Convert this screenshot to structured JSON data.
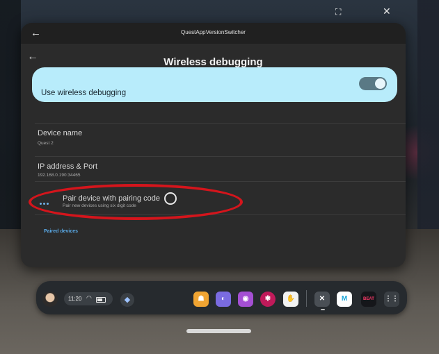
{
  "window": {
    "title": "QuestAppVersionSwitcher",
    "back_glyph": "←",
    "expand_glyph": "⛶",
    "close_glyph": "✕"
  },
  "page": {
    "back_glyph": "←",
    "title": "Wireless debugging"
  },
  "toggle": {
    "label": "Use wireless debugging",
    "state": "on"
  },
  "settings": {
    "device_name": {
      "title": "Device name",
      "value": "Quest 2"
    },
    "ip_address": {
      "title": "IP address & Port",
      "value": "192.168.0.190:34465"
    },
    "pair": {
      "title": "Pair device with pairing code",
      "subtitle": "Pair new devices using six digit code"
    },
    "paired_section": "Paired devices"
  },
  "dock": {
    "time": "11:20",
    "wifi_icon": "wifi-icon",
    "battery_icon": "battery-icon",
    "notification_icon": "bell-icon",
    "apps": [
      {
        "name": "app-orange",
        "color": "#f0a432",
        "glyph": "☗"
      },
      {
        "name": "app-purple-blue",
        "color": "#7a6be0",
        "glyph": "◐"
      },
      {
        "name": "app-people",
        "color": "#a44fd3",
        "glyph": "◉"
      },
      {
        "name": "app-pink-wheel",
        "color": "#c01a5a",
        "glyph": "✱"
      },
      {
        "name": "app-white-figure",
        "color": "#f2f2f2",
        "glyph": "✋"
      },
      {
        "name": "app-x",
        "color": "#4a4f55",
        "glyph": "✕"
      },
      {
        "name": "app-m",
        "color": "#ffffff",
        "glyph": "M"
      },
      {
        "name": "app-beat-saber",
        "color": "#15161a",
        "glyph": "BEAT"
      },
      {
        "name": "app-grid",
        "color": "#3a3f44",
        "glyph": "⋮⋮"
      }
    ]
  }
}
